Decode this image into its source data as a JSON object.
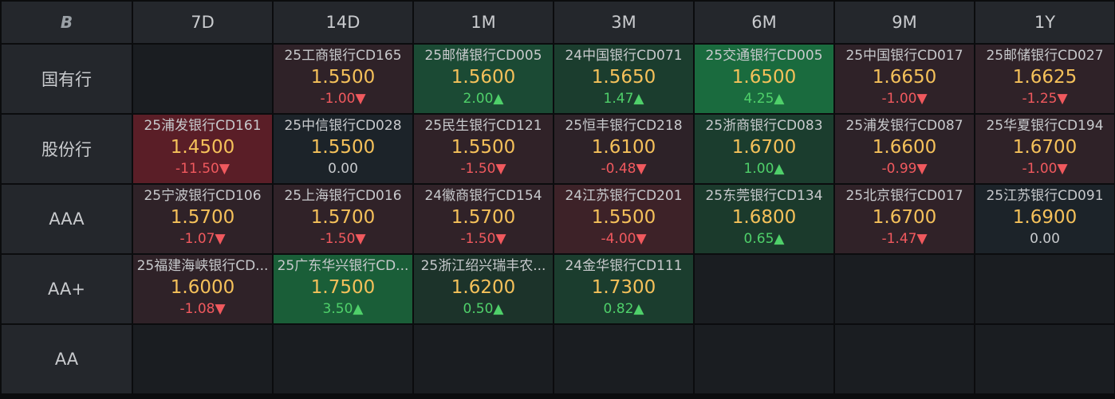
{
  "logo_text": "B",
  "columns": [
    "7D",
    "14D",
    "1M",
    "3M",
    "6M",
    "9M",
    "1Y"
  ],
  "rows": [
    {
      "label": "国有行",
      "cells": [
        null,
        {
          "name": "25工商银行CD165",
          "price": "1.5500",
          "change": "-1.00▼",
          "dir": "down",
          "bg": "#2f2228"
        },
        {
          "name": "25邮储银行CD005",
          "price": "1.5600",
          "change": "2.00▲",
          "dir": "up",
          "bg": "#1b4a34"
        },
        {
          "name": "24中国银行CD071",
          "price": "1.5650",
          "change": "1.47▲",
          "dir": "up",
          "bg": "#1b3d2e"
        },
        {
          "name": "25交通银行CD005",
          "price": "1.6500",
          "change": "4.25▲",
          "dir": "up",
          "bg": "#1a6b3e"
        },
        {
          "name": "25中国银行CD017",
          "price": "1.6650",
          "change": "-1.00▼",
          "dir": "down",
          "bg": "#2f2228"
        },
        {
          "name": "25邮储银行CD027",
          "price": "1.6625",
          "change": "-1.25▼",
          "dir": "down",
          "bg": "#2f2228"
        }
      ]
    },
    {
      "label": "股份行",
      "cells": [
        {
          "name": "25浦发银行CD161",
          "price": "1.4500",
          "change": "-11.50▼",
          "dir": "down",
          "bg": "#5a1e27"
        },
        {
          "name": "25中信银行CD028",
          "price": "1.5500",
          "change": "0.00",
          "dir": "flat",
          "bg": "#1c2329"
        },
        {
          "name": "25民生银行CD121",
          "price": "1.5500",
          "change": "-1.50▼",
          "dir": "down",
          "bg": "#302228"
        },
        {
          "name": "25恒丰银行CD218",
          "price": "1.6100",
          "change": "-0.48▼",
          "dir": "down",
          "bg": "#2d2228"
        },
        {
          "name": "25浙商银行CD083",
          "price": "1.6700",
          "change": "1.00▲",
          "dir": "up",
          "bg": "#1b3d2e"
        },
        {
          "name": "25浦发银行CD087",
          "price": "1.6600",
          "change": "-0.99▼",
          "dir": "down",
          "bg": "#2d2228"
        },
        {
          "name": "25华夏银行CD194",
          "price": "1.6700",
          "change": "-1.00▼",
          "dir": "down",
          "bg": "#2f2228"
        }
      ]
    },
    {
      "label": "AAA",
      "cells": [
        {
          "name": "25宁波银行CD106",
          "price": "1.5700",
          "change": "-1.07▼",
          "dir": "down",
          "bg": "#2f2228"
        },
        {
          "name": "25上海银行CD016",
          "price": "1.5700",
          "change": "-1.50▼",
          "dir": "down",
          "bg": "#302228"
        },
        {
          "name": "24徽商银行CD154",
          "price": "1.5700",
          "change": "-1.50▼",
          "dir": "down",
          "bg": "#302228"
        },
        {
          "name": "24江苏银行CD201",
          "price": "1.5500",
          "change": "-4.00▼",
          "dir": "down",
          "bg": "#3d2228"
        },
        {
          "name": "25东莞银行CD134",
          "price": "1.6800",
          "change": "0.65▲",
          "dir": "up",
          "bg": "#1b3a2c"
        },
        {
          "name": "25北京银行CD017",
          "price": "1.6700",
          "change": "-1.47▼",
          "dir": "down",
          "bg": "#302228"
        },
        {
          "name": "25江苏银行CD091",
          "price": "1.6900",
          "change": "0.00",
          "dir": "flat",
          "bg": "#1c2329"
        }
      ]
    },
    {
      "label": "AA+",
      "cells": [
        {
          "name": "25福建海峡银行CD...",
          "price": "1.6000",
          "change": "-1.08▼",
          "dir": "down",
          "bg": "#2f2228"
        },
        {
          "name": "25广东华兴银行CD...",
          "price": "1.7500",
          "change": "3.50▲",
          "dir": "up",
          "bg": "#1a5e38"
        },
        {
          "name": "25浙江绍兴瑞丰农...",
          "price": "1.6200",
          "change": "0.50▲",
          "dir": "up",
          "bg": "#1c332a"
        },
        {
          "name": "24金华银行CD111",
          "price": "1.7300",
          "change": "0.82▲",
          "dir": "up",
          "bg": "#1b3d2e"
        },
        null,
        null,
        null
      ]
    },
    {
      "label": "AA",
      "cells": [
        null,
        null,
        null,
        null,
        null,
        null,
        null
      ]
    }
  ]
}
